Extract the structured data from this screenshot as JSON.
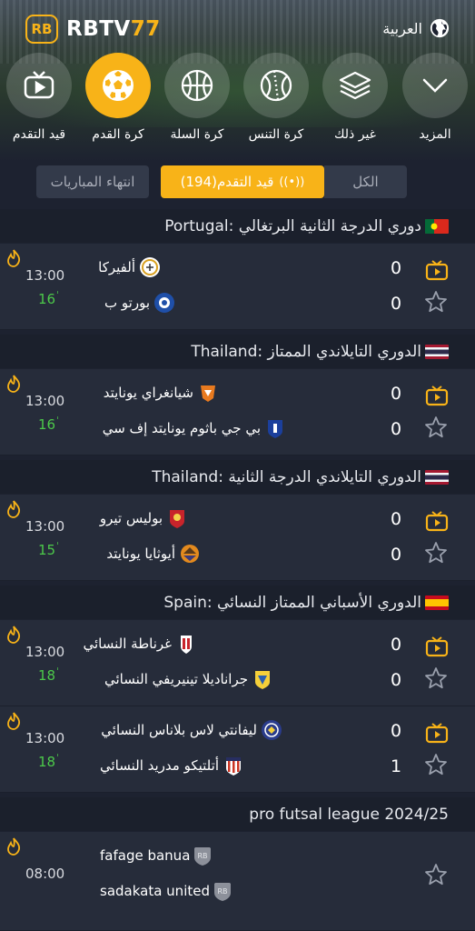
{
  "header": {
    "logo_badge": "RB",
    "logo_name": "RBTV",
    "logo_num": "77",
    "language": "العربية"
  },
  "categories": [
    {
      "label": "قيد التقدم",
      "icon": "live-tv-icon"
    },
    {
      "label": "كرة القدم",
      "icon": "soccer-ball-icon",
      "active": true
    },
    {
      "label": "كرة السلة",
      "icon": "basketball-icon"
    },
    {
      "label": "كرة التنس",
      "icon": "tennis-ball-icon"
    },
    {
      "label": "غير ذلك",
      "icon": "layers-icon"
    },
    {
      "label": "المزيد",
      "icon": "chevron-down-icon"
    }
  ],
  "filters": {
    "finished": "انتهاء المباريات",
    "live": "قيد التقدم(194)",
    "all": "الكل"
  },
  "leagues": [
    {
      "name": "Portugal: دوري الدرجة الثانية البرتغالي",
      "flag": "portugal-flag",
      "matches": [
        {
          "time": "13:00",
          "minute": "16",
          "home": "ألفيركا",
          "away": "بورتو ب",
          "home_score": "0",
          "away_score": "0"
        }
      ]
    },
    {
      "name": "Thailand: الدوري التايلاندي الممتاز",
      "flag": "thailand-flag",
      "matches": [
        {
          "time": "13:00",
          "minute": "16",
          "home": "شيانغراي يونايتد",
          "away": "بي جي باثوم يونايتد إف سي",
          "home_score": "0",
          "away_score": "0"
        }
      ]
    },
    {
      "name": "Thailand: الدوري التايلاندي الدرجة الثانية",
      "flag": "thailand-flag",
      "matches": [
        {
          "time": "13:00",
          "minute": "15",
          "home": "بوليس تيرو",
          "away": "أيوثايا يونايتد",
          "home_score": "0",
          "away_score": "0"
        }
      ]
    },
    {
      "name": "Spain: الدوري الأسباني الممتاز النسائي",
      "flag": "spain-flag",
      "matches": [
        {
          "time": "13:00",
          "minute": "18",
          "home": "غرناطة النسائي",
          "away": "جراناديلا تينيريفي النسائي",
          "home_score": "0",
          "away_score": "0"
        },
        {
          "time": "13:00",
          "minute": "18",
          "home": "ليفانتي لاس بلاناس النسائي",
          "away": "أتلتيكو مدريد النسائي",
          "home_score": "0",
          "away_score": "1"
        }
      ]
    },
    {
      "name": "pro futsal league 2024/25",
      "matches": [
        {
          "time": "08:00",
          "home": "fafage banua",
          "away": "sadakata united"
        }
      ]
    }
  ],
  "colors": {
    "accent": "#f8b318",
    "live_minute": "#4cc94a",
    "background": "#1d2230",
    "row": "#262c3a"
  }
}
